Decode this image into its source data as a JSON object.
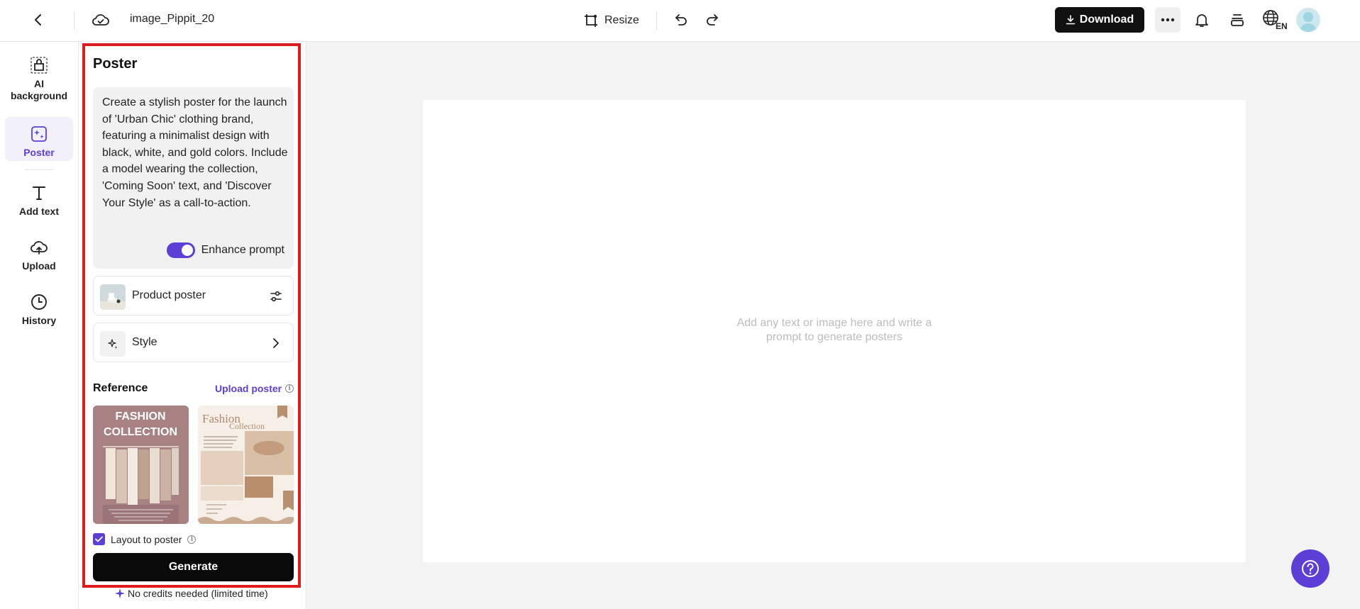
{
  "header": {
    "file_title": "image_Pippit_20",
    "resize_label": "Resize",
    "download_label": "Download",
    "lang_label": "EN"
  },
  "rail": {
    "items": [
      {
        "label": "AI background",
        "icon": "bag-icon"
      },
      {
        "label": "Poster",
        "icon": "poster-icon",
        "active": true
      },
      {
        "label": "Add text",
        "icon": "text-icon"
      },
      {
        "label": "Upload",
        "icon": "upload-cloud-icon"
      },
      {
        "label": "History",
        "icon": "clock-icon"
      }
    ]
  },
  "panel": {
    "title": "Poster",
    "prompt": "Create a stylish poster for the launch of 'Urban Chic' clothing brand, featuring a minimalist design with black, white, and gold colors. Include a model wearing the collection, 'Coming Soon' text, and 'Discover Your Style' as a call-to-action.",
    "enhance_label": "Enhance prompt",
    "enhance_on": true,
    "product_poster_label": "Product poster",
    "style_label": "Style",
    "reference_title": "Reference",
    "upload_poster_label": "Upload poster",
    "ref1": {
      "line1": "FASHION",
      "line2": "COLLECTION"
    },
    "ref2": {
      "line1": "Fashion",
      "line2": "Collection"
    },
    "layout_label": "Layout to poster",
    "layout_checked": true,
    "generate_label": "Generate",
    "credits_text": "No credits needed (limited time)"
  },
  "canvas": {
    "hint": "Add any text or image here and write a prompt to generate posters"
  },
  "colors": {
    "accent": "#5b3fd6",
    "highlight_frame": "#e01b1b",
    "button_dark": "#111111"
  }
}
